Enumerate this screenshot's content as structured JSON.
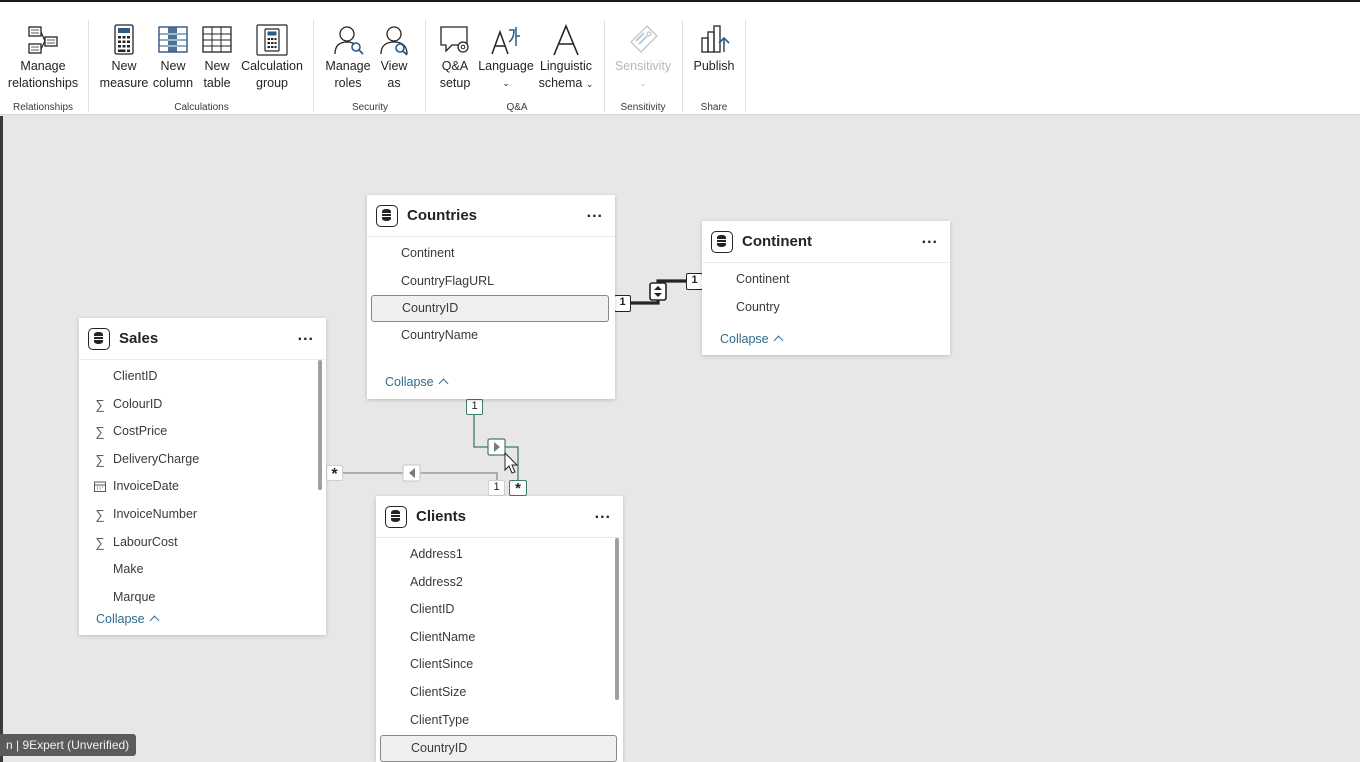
{
  "ribbon": {
    "groups": {
      "relationships": {
        "label": "Relationships",
        "buttons": [
          {
            "label1": "Manage",
            "label2": "relationships",
            "icon": "manage-relationships-icon"
          }
        ]
      },
      "calculations": {
        "label": "Calculations",
        "buttons": [
          {
            "label1": "New",
            "label2": "measure",
            "icon": "calculator-icon"
          },
          {
            "label1": "New",
            "label2": "column",
            "icon": "new-column-icon"
          },
          {
            "label1": "New",
            "label2": "table",
            "icon": "new-table-icon"
          },
          {
            "label1": "Calculation",
            "label2": "group",
            "icon": "calculation-group-icon"
          }
        ]
      },
      "security": {
        "label": "Security",
        "buttons": [
          {
            "label1": "Manage",
            "label2": "roles",
            "icon": "manage-roles-icon"
          },
          {
            "label1": "View",
            "label2": "as",
            "icon": "view-as-icon"
          }
        ]
      },
      "qa": {
        "label": "Q&A",
        "buttons": [
          {
            "label1": "Q&A",
            "label2": "setup",
            "icon": "qa-setup-icon"
          },
          {
            "label1": "Language",
            "label2": "",
            "icon": "language-icon"
          },
          {
            "label1": "Linguistic",
            "label2": "schema",
            "icon": "linguistic-schema-icon"
          }
        ]
      },
      "sensitivity": {
        "label": "Sensitivity",
        "buttons": [
          {
            "label1": "Sensitivity",
            "label2": "",
            "icon": "sensitivity-icon"
          }
        ]
      },
      "share": {
        "label": "Share",
        "buttons": [
          {
            "label1": "Publish",
            "label2": "",
            "icon": "publish-icon"
          }
        ]
      }
    }
  },
  "tables": {
    "countries": {
      "title": "Countries",
      "more": "...",
      "fields": [
        "Continent",
        "CountryFlagURL",
        "CountryID",
        "CountryName"
      ],
      "selected": "CountryID",
      "collapse": "Collapse"
    },
    "continent": {
      "title": "Continent",
      "more": "...",
      "fields": [
        "Continent",
        "Country"
      ],
      "collapse": "Collapse"
    },
    "sales": {
      "title": "Sales",
      "more": "...",
      "fields": [
        {
          "name": "ClientID",
          "icon": ""
        },
        {
          "name": "ColourID",
          "icon": "sigma-icon"
        },
        {
          "name": "CostPrice",
          "icon": "sigma-icon"
        },
        {
          "name": "DeliveryCharge",
          "icon": "sigma-icon"
        },
        {
          "name": "InvoiceDate",
          "icon": "calendar-icon"
        },
        {
          "name": "InvoiceNumber",
          "icon": "sigma-icon"
        },
        {
          "name": "LabourCost",
          "icon": "sigma-icon"
        },
        {
          "name": "Make",
          "icon": ""
        },
        {
          "name": "Marque",
          "icon": ""
        }
      ],
      "collapse": "Collapse"
    },
    "clients": {
      "title": "Clients",
      "more": "...",
      "fields": [
        "Address1",
        "Address2",
        "ClientID",
        "ClientName",
        "ClientSince",
        "ClientSize",
        "ClientType",
        "CountryID"
      ],
      "selected": "CountryID"
    }
  },
  "relationships": {
    "countries_continent": {
      "from_card": "1",
      "to_card": "1"
    },
    "countries_clients": {
      "one": "1",
      "many": "*",
      "one_near_clients": "1"
    },
    "sales_clients": {
      "many": "*"
    }
  },
  "status_tag": "n | 9Expert (Unverified)"
}
